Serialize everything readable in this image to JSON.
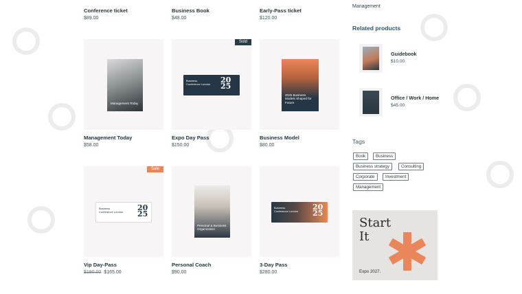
{
  "products": [
    {
      "name": "Conference ticket",
      "price": "$89.00"
    },
    {
      "name": "Business Book",
      "price": "$48.00"
    },
    {
      "name": "Early-Pass ticket",
      "price": "$120.00"
    },
    {
      "name": "Management Today",
      "price": "$58.00"
    },
    {
      "name": "Expo Day Pass",
      "price": "$150.00",
      "badge": "Sold"
    },
    {
      "name": "Business Model",
      "price": "$80.00"
    },
    {
      "name": "Vip Day-Pass",
      "old_price": "$180.00",
      "price": "$165.00",
      "badge": "Sale"
    },
    {
      "name": "Personal Coach",
      "price": "$90.00"
    },
    {
      "name": "3-Day Pass",
      "price": "$280.00"
    }
  ],
  "art": {
    "management_book": "Management Today",
    "ticket_text": "Business Conference London",
    "ticket_number": "20 25",
    "business_model_book": "2025 Business Models Shaped for Future",
    "coach_book": "Personal & Business Organization"
  },
  "sidebar": {
    "category": "Management",
    "related_heading": "Related products",
    "related": [
      {
        "name": "Guidebook",
        "price": "$10.00"
      },
      {
        "name": "Office / Work / Home",
        "price": "$45.00"
      }
    ],
    "tags_heading": "Tags",
    "tags": [
      "Book",
      "Business",
      "Business strategy",
      "Consulting",
      "Corporate",
      "Investment",
      "Management"
    ],
    "promo": {
      "title": "Start\nIt",
      "subtitle": "Expo 2027."
    }
  },
  "colors": {
    "accent": "#e9875a",
    "dark": "#283c48",
    "heading": "#2b5564"
  }
}
